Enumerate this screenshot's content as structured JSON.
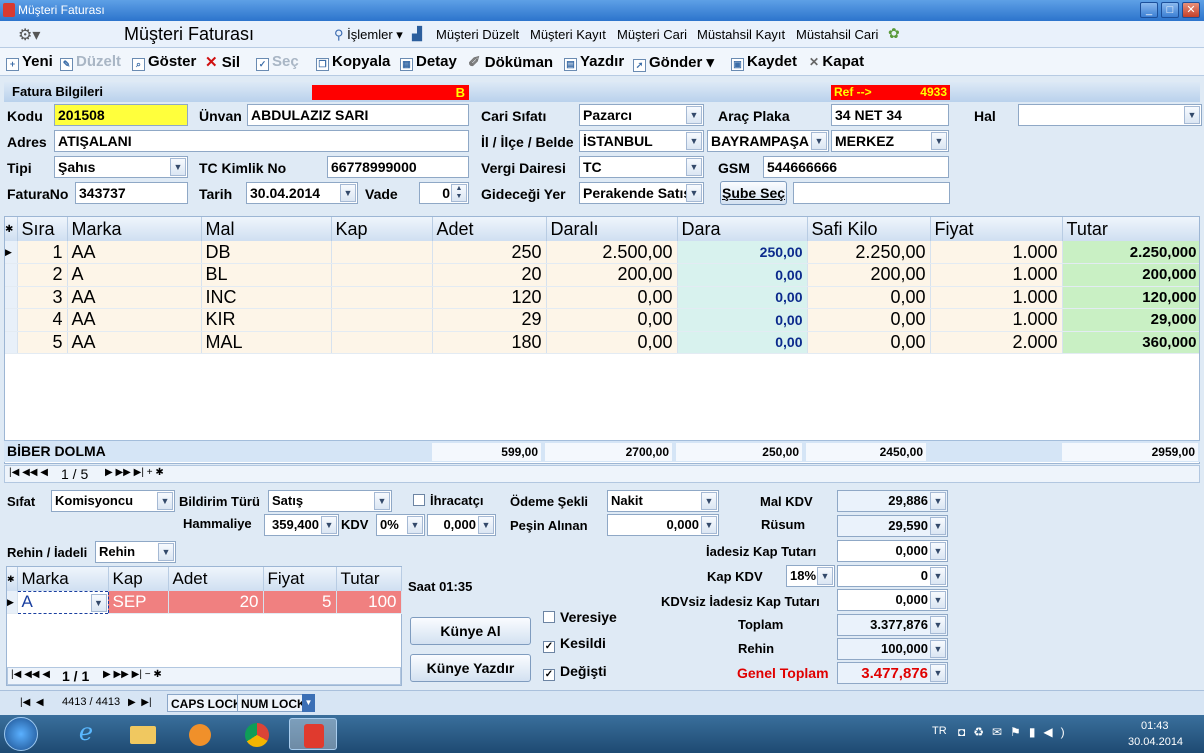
{
  "window": {
    "title": "Müşteri Faturası",
    "min": "_",
    "max": "□",
    "close": "✕"
  },
  "menu": {
    "app_title": "Müşteri Faturası",
    "islemler": "İşlemler",
    "musteri_duzelt": "Müşteri Düzelt",
    "musteri_kayit": "Müşteri Kayıt",
    "musteri_cari": "Müşteri Cari",
    "mustahsil_kayit": "Müstahsil Kayıt",
    "mustahsil_cari": "Müstahsil Cari"
  },
  "toolbar": {
    "yeni": "Yeni",
    "duzelt": "Düzelt",
    "goster": "Göster",
    "sil": "Sil",
    "sec": "Seç",
    "kopyala": "Kopyala",
    "detay": "Detay",
    "dokuman": "Döküman",
    "yazdir": "Yazdır",
    "gonder": "Gönder",
    "kaydet": "Kaydet",
    "kapat": "Kapat"
  },
  "fatura": {
    "header": "Fatura Bilgileri",
    "red_letter": "B",
    "ref_label": "Ref -->",
    "ref_value": "4933",
    "kodu_label": "Kodu",
    "kodu": "201508",
    "unvan_label": "Ünvan",
    "unvan": "ABDULAZIZ SARI",
    "cari_sifati_label": "Cari Sıfatı",
    "cari_sifati": "Pazarcı",
    "arac_plaka_label": "Araç Plaka",
    "arac_plaka": "34 NET 34",
    "hal_label": "Hal",
    "hal": "",
    "adres_label": "Adres",
    "adres": "ATIŞALANI",
    "il_label": "İl / İlçe / Belde",
    "il": "İSTANBUL",
    "ilce": "BAYRAMPAŞA",
    "belde": "MERKEZ",
    "tipi_label": "Tipi",
    "tipi": "Şahıs",
    "tc_label": "TC Kimlik No",
    "tc": "66778999000",
    "vergi_label": "Vergi Dairesi",
    "vergi": "TC",
    "gsm_label": "GSM",
    "gsm": "544666666",
    "faturano_label": "FaturaNo",
    "faturano": "343737",
    "tarih_label": "Tarih",
    "tarih": "30.04.2014",
    "vade_label": "Vade",
    "vade": "0",
    "gidecegi_label": "Gideceği Yer",
    "gidecegi": "Perakende Satış",
    "sube_button": "Şube Seç",
    "sube": ""
  },
  "items": {
    "columns": [
      "Sıra",
      "Marka",
      "Mal",
      "Kap",
      "Adet",
      "Daralı",
      "Dara",
      "Safi Kilo",
      "Fiyat",
      "Tutar"
    ],
    "rows": [
      {
        "sira": "1",
        "marka": "AA",
        "mal": "DB",
        "kap": "",
        "adet": "250",
        "darali": "2.500,00",
        "dara": "250,00",
        "safi": "2.250,00",
        "fiyat": "1.000",
        "tutar": "2.250,000"
      },
      {
        "sira": "2",
        "marka": "A",
        "mal": "BL",
        "kap": "",
        "adet": "20",
        "darali": "200,00",
        "dara": "0,00",
        "safi": "200,00",
        "fiyat": "1.000",
        "tutar": "200,000"
      },
      {
        "sira": "3",
        "marka": "AA",
        "mal": "INC",
        "kap": "",
        "adet": "120",
        "darali": "0,00",
        "dara": "0,00",
        "safi": "0,00",
        "fiyat": "1.000",
        "tutar": "120,000"
      },
      {
        "sira": "4",
        "marka": "AA",
        "mal": "KIR",
        "kap": "",
        "adet": "29",
        "darali": "0,00",
        "dara": "0,00",
        "safi": "0,00",
        "fiyat": "1.000",
        "tutar": "29,000"
      },
      {
        "sira": "5",
        "marka": "AA",
        "mal": "MAL",
        "kap": "",
        "adet": "180",
        "darali": "0,00",
        "dara": "0,00",
        "safi": "0,00",
        "fiyat": "2.000",
        "tutar": "360,000"
      }
    ],
    "summary_label": "BİBER DOLMA",
    "sum_adet": "599,00",
    "sum_darali": "2700,00",
    "sum_dara": "250,00",
    "sum_safi": "2450,00",
    "sum_tutar": "2959,00",
    "nav": "1 / 5"
  },
  "bottom": {
    "sifat_label": "Sıfat",
    "sifat": "Komisyoncu",
    "bildirim_label": "Bildirim Türü",
    "bildirim": "Satış",
    "ihracatci": "İhracatçı",
    "odeme_label": "Ödeme Şekli",
    "odeme": "Nakit",
    "hammaliye_label": "Hammaliye",
    "hammaliye": "359,400",
    "kdv_label": "KDV",
    "kdv_pct": "0%",
    "kdv_val": "0,000",
    "pesin_label": "Peşin Alınan",
    "pesin": "0,000",
    "rehin_label": "Rehin / İadeli",
    "rehin": "Rehin",
    "saat": "Saat  01:35",
    "kunye_al": "Künye Al",
    "kunye_yazdir": "Künye Yazdır",
    "veresiye": "Veresiye",
    "kesildi": "Kesildi",
    "degisti": "Değişti"
  },
  "rehin_grid": {
    "columns": [
      "Marka",
      "Kap",
      "Adet",
      "Fiyat",
      "Tutar"
    ],
    "row": {
      "marka": "A",
      "kap": "SEP",
      "adet": "20",
      "fiyat": "5",
      "tutar": "100"
    },
    "nav": "1 / 1"
  },
  "totals": {
    "mal_kdv_label": "Mal KDV",
    "mal_kdv": "29,886",
    "rusum_label": "Rüsum",
    "rusum": "29,590",
    "iadesiz_label": "İadesiz Kap Tutarı",
    "iadesiz": "0,000",
    "kap_kdv_label": "Kap KDV",
    "kap_kdv_pct": "18%",
    "kap_kdv": "0",
    "kdvsiz_label": "KDVsiz İadesiz Kap Tutarı",
    "kdvsiz": "0,000",
    "toplam_label": "Toplam",
    "toplam": "3.377,876",
    "rehin_label": "Rehin",
    "rehin": "100,000",
    "genel_label": "Genel Toplam",
    "genel": "3.477,876"
  },
  "statusbar": {
    "record": "4413 / 4413",
    "caps": "CAPS LOCK",
    "num": "NUM LOCK"
  },
  "taskbar": {
    "lang": "TR",
    "time": "01:43",
    "date": "30.04.2014"
  },
  "colors": {
    "accent": "#2c74cc",
    "red": "#ff0000",
    "yellow": "#ffff00",
    "green_cell": "#c9f0c4",
    "dara_cell": "#d8f2ee"
  }
}
